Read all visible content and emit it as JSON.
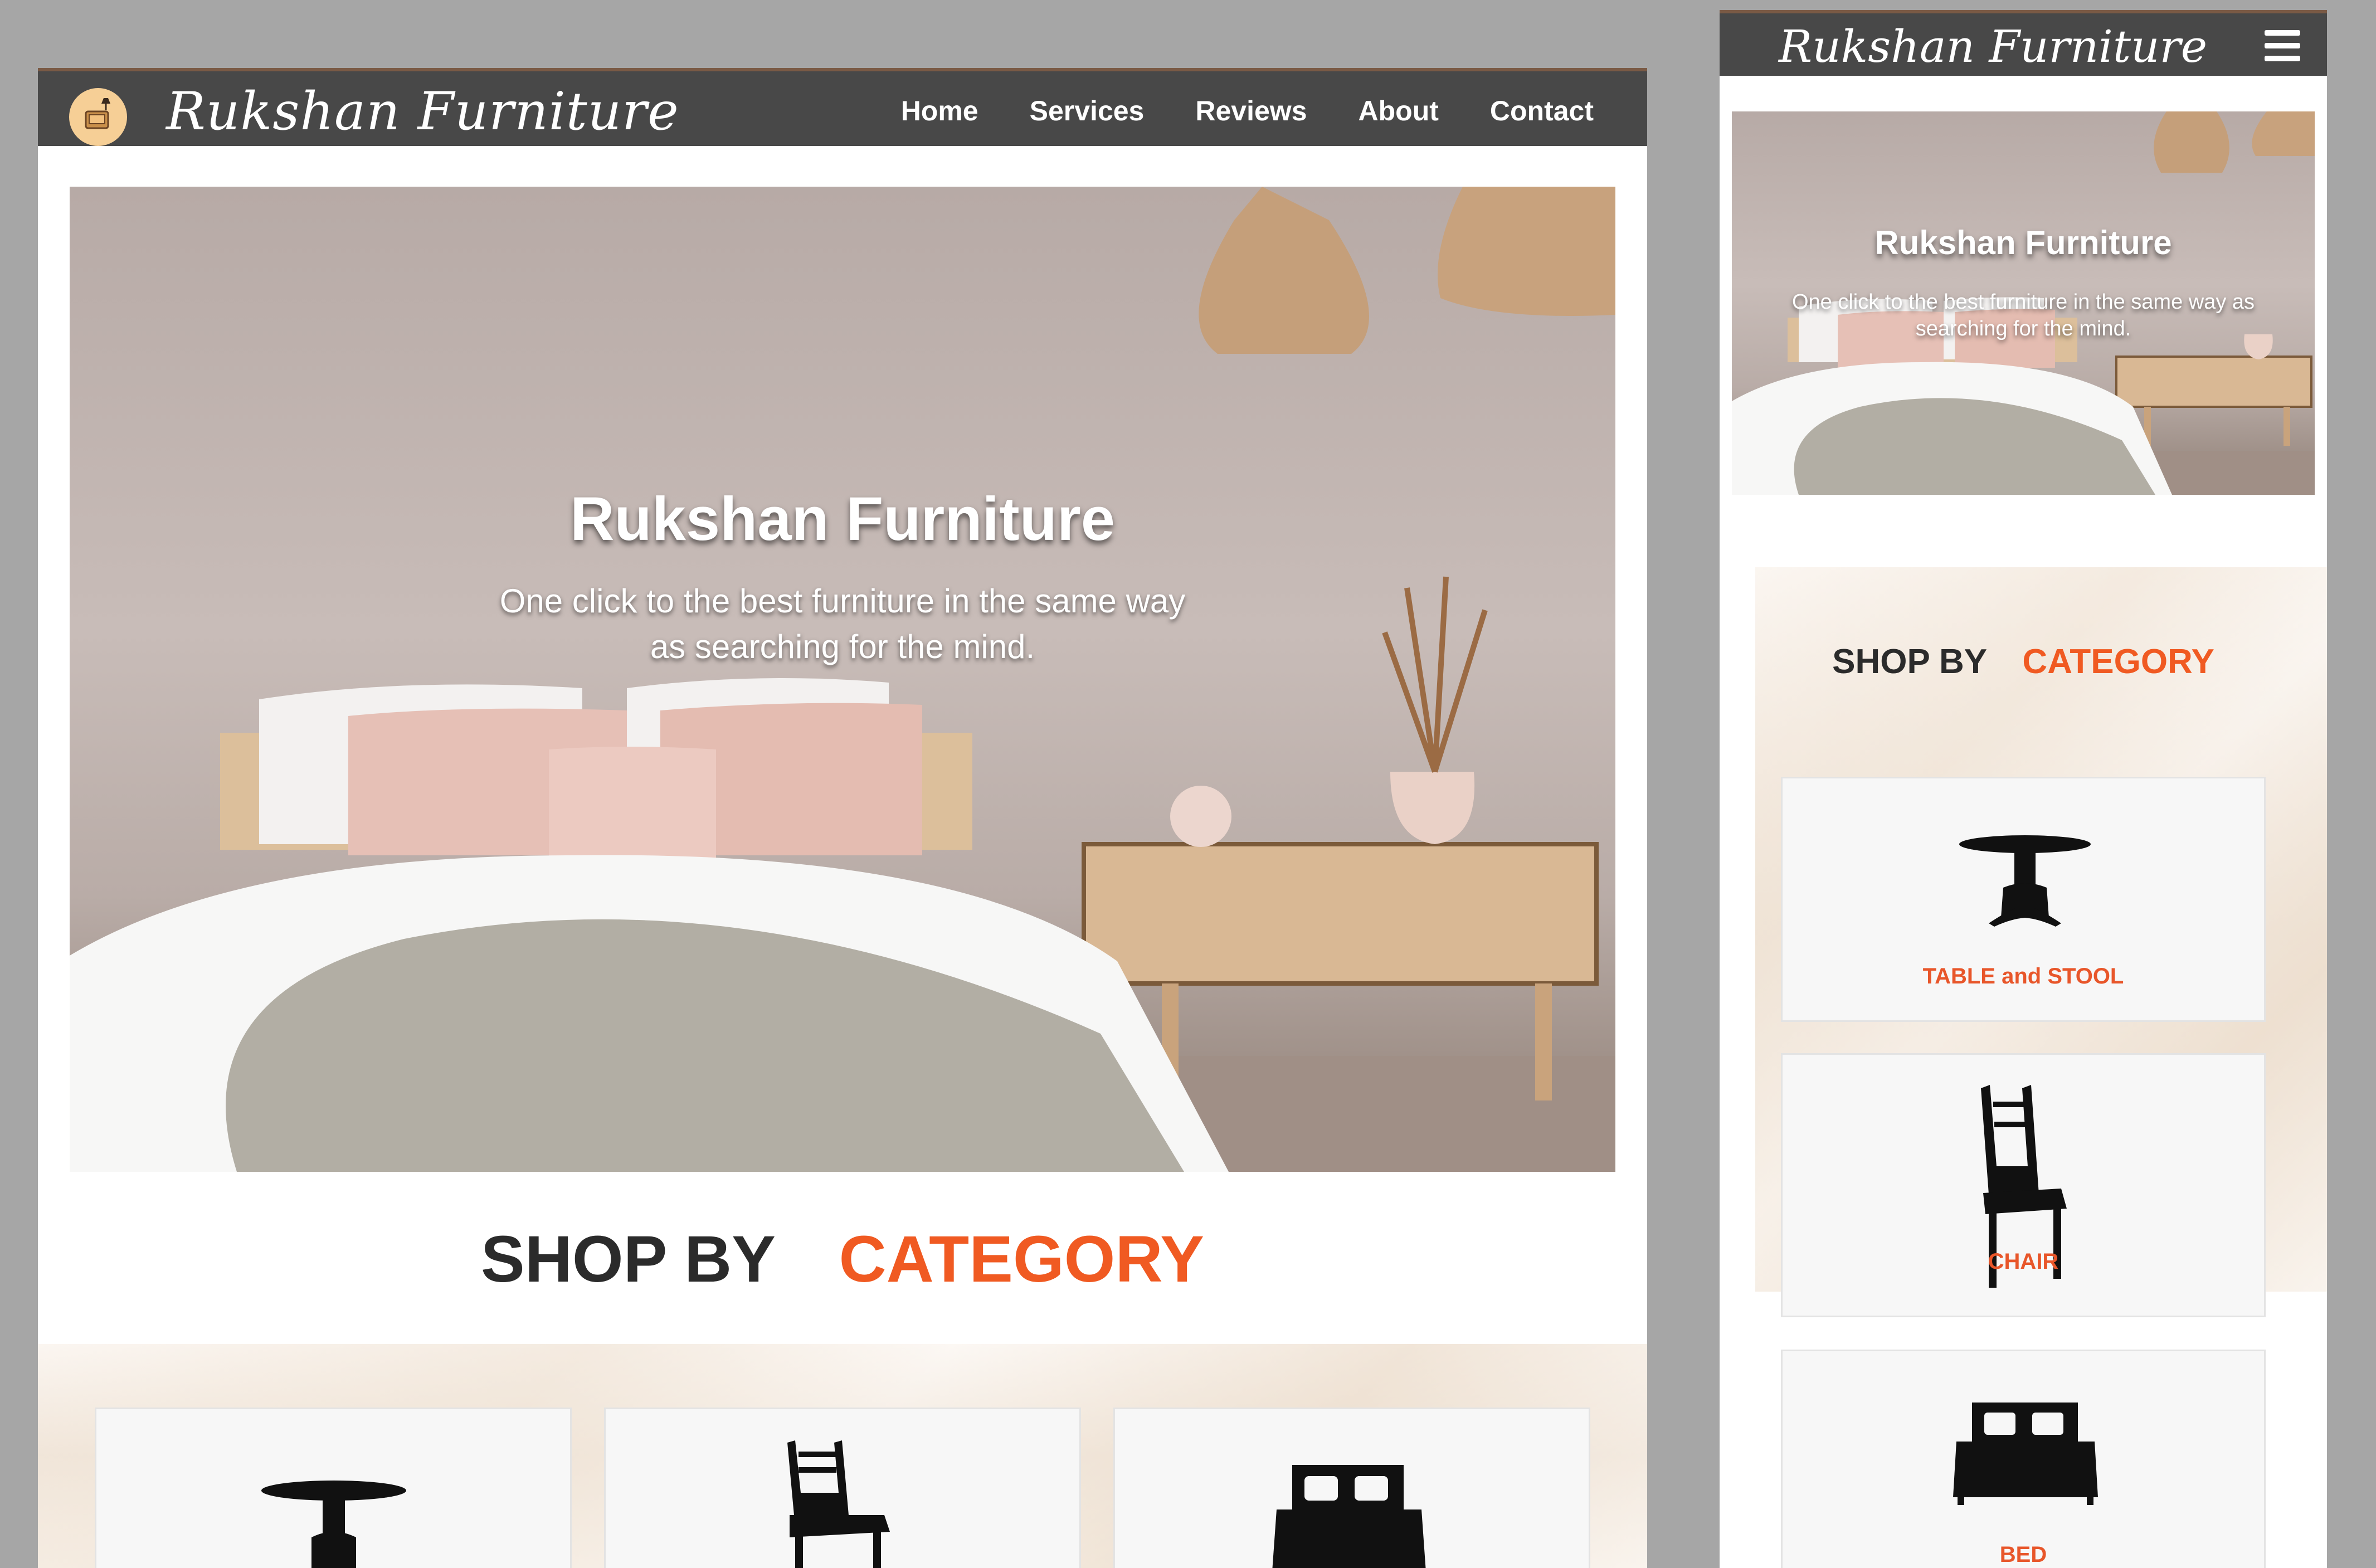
{
  "desktop": {
    "brand": "Rukshan Furniture",
    "nav": [
      "Home",
      "Services",
      "Reviews",
      "About",
      "Contact"
    ],
    "hero": {
      "title": "Rukshan Furniture",
      "subtitle_line1": "One click to the best furniture in the same way",
      "subtitle_line2": "as searching for the mind."
    },
    "shop": {
      "part1": "SHOP BY",
      "part2": "CATEGORY"
    }
  },
  "mobile": {
    "brand": "Rukshan Furniture",
    "hero": {
      "title": "Rukshan Furniture",
      "subtitle_line1": "One click to the best furniture in the same way as",
      "subtitle_line2": "searching for the mind."
    },
    "shop": {
      "part1": "SHOP BY",
      "part2": "CATEGORY"
    },
    "categories": [
      "TABLE and STOOL",
      "CHAIR",
      "BED"
    ]
  },
  "colors": {
    "nav_bg": "#484848",
    "accent": "#f05a22",
    "page_bg": "#a6a6a6"
  },
  "icons": [
    "logo-badge",
    "table-icon",
    "chair-icon",
    "bed-icon",
    "hamburger-menu-icon"
  ]
}
